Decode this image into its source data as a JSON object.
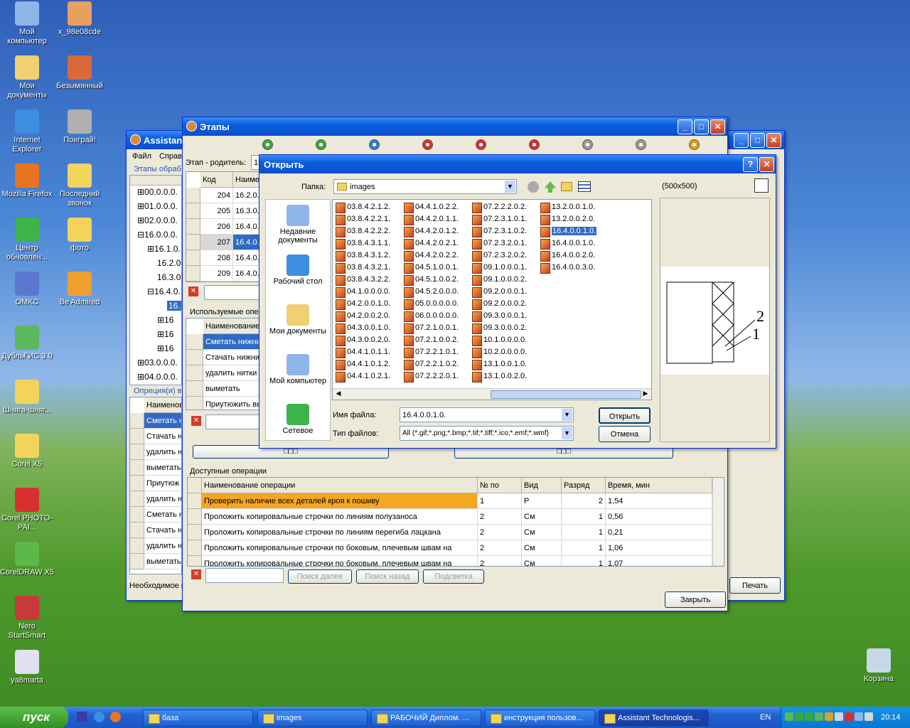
{
  "desktop_icons": [
    {
      "label": "Мой компьютер"
    },
    {
      "label": "x_98e08cde"
    },
    {
      "label": "Мои документы"
    },
    {
      "label": "Безымянный"
    },
    {
      "label": "Internet Explorer"
    },
    {
      "label": "Поиграй!"
    },
    {
      "label": "Mozilla Firefox"
    },
    {
      "label": "Последний звонок"
    },
    {
      "label": "Центр обновлен..."
    },
    {
      "label": "фото"
    },
    {
      "label": "OMKC"
    },
    {
      "label": "Be Admired"
    },
    {
      "label": "ДубльГИС 3.0"
    },
    {
      "label": "Шняга-шняг..."
    },
    {
      "label": "Corel X5"
    },
    {
      "label": "Corel PHOTO-PAI..."
    },
    {
      "label": "CorelDRAW X5"
    },
    {
      "label": "Nero StartSmart"
    },
    {
      "label": "ya8marta"
    },
    {
      "label": "Корзина"
    }
  ],
  "assistant_window": {
    "title": "Assistant",
    "menu": [
      "Файл",
      "Справ"
    ],
    "stages_label": "Этапы обраб",
    "tree": [
      "⊞00.0.0.0.",
      "⊞01.0.0.0.",
      "⊞02.0.0.0.",
      "⊟16.0.0.0.",
      "⊞16.1.0.",
      "16.2.0.",
      "16.3.0.",
      "⊟16.4.0.",
      "16.",
      "⊞16",
      "⊞16",
      "⊞16",
      "⊞03.0.0.0.",
      "⊞04.0.0.0.",
      "⊞05.0.0.0."
    ],
    "ops_label": "Опреция(и) в",
    "ops_header": "Наименов",
    "ops_rows": [
      "Сметать н",
      "Стачать н",
      "удалить н",
      "выметать",
      "Приутюж",
      "удалить н",
      "Сметать н",
      "Стачать н",
      "удалить н",
      "выметать"
    ],
    "status": "Необходимое в",
    "print_button": "Печать"
  },
  "stages_window": {
    "title": "Этапы",
    "parent_label": "Этап - родитель:",
    "parent_value": "16",
    "columns": [
      "Код",
      "Наимен"
    ],
    "rows": [
      {
        "code": "204",
        "name": "16.2.0."
      },
      {
        "code": "205",
        "name": "16.3.0."
      },
      {
        "code": "206",
        "name": "16.4.0."
      },
      {
        "code": "207",
        "name": "16.4.0."
      },
      {
        "code": "208",
        "name": "16.4.0."
      },
      {
        "code": "209",
        "name": "16.4.0."
      }
    ],
    "used_ops_label": "Используемые опер",
    "used_ops_header": "Наименование",
    "used_ops": [
      "Сметать нижни",
      "Стачать нижни",
      "удалить нитки",
      "выметать",
      "Приутюжить вы"
    ],
    "bottom_btn1": "□□□",
    "bottom_btn2": "□□□",
    "avail_label": "Доступные операции",
    "avail_columns": [
      "Наименование операции",
      "№ по",
      "Вид",
      "Разряд",
      "Время, мин"
    ],
    "avail_rows": [
      {
        "name": "Проверить наличие всех деталей кроя к пошиву",
        "num": "1",
        "kind": "Р",
        "grade": "2",
        "time": "1,54"
      },
      {
        "name": "Проложить копировальные строчки по линиям полузаноса",
        "num": "2",
        "kind": "См",
        "grade": "1",
        "time": "0,56"
      },
      {
        "name": "Проложить копировальные строчки по линиям перегиба лацкана",
        "num": "2",
        "kind": "См",
        "grade": "1",
        "time": "0,21"
      },
      {
        "name": "Проложить копировальные строчки по боковым, плечевым швам на",
        "num": "2",
        "kind": "См",
        "grade": "1",
        "time": "1,06"
      },
      {
        "name": "Проложить копировальные строчки по боковым, плечевым швам на",
        "num": "2",
        "kind": "См",
        "grade": "1",
        "time": "1,07"
      }
    ],
    "search_next": "Поиск далее",
    "search_prev": "Поиск назад",
    "highlight": "Подсветка",
    "close_button": "Закрыть"
  },
  "open_dialog": {
    "title": "Открыть",
    "folder_label": "Папка:",
    "folder_value": "images",
    "places": [
      "Недавние документы",
      "Рабочий стол",
      "Мои документы",
      "Мой компьютер",
      "Сетевое"
    ],
    "files": [
      "03.8.4.2.1.2.",
      "03.8.4.2.2.1.",
      "03.8.4.2.2.2.",
      "03.8.4.3.1.1.",
      "03.8.4.3.1.2.",
      "03.8.4.3.2.1.",
      "03.8.4.3.2.2.",
      "04.1.0.0.0.0.",
      "04.2.0.0.1.0.",
      "04.2.0.0.2.0.",
      "04.3.0.0.1.0.",
      "04.3.0.0.2.0.",
      "04.4.1.0.1.1.",
      "04.4.1.0.1.2.",
      "04.4.1.0.2.1.",
      "04.4.1.0.2.2.",
      "04.4.2.0.1.1.",
      "04.4.2.0.1.2.",
      "04.4.2.0.2.1.",
      "04.4.2.0.2.2.",
      "04.5.1.0.0.1.",
      "04.5.1.0.0.2.",
      "04.5.2.0.0.0.",
      "05.0.0.0.0.0.",
      "06.0.0.0.0.0.",
      "07.2.1.0.0.1.",
      "07.2.1.0.0.2.",
      "07.2.2.1.0.1.",
      "07.2.2.1.0.2.",
      "07.2.2.2.0.1.",
      "07.2.2.2.0.2.",
      "07.2.3.1.0.1.",
      "07.2.3.1.0.2.",
      "07.2.3.2.0.1.",
      "07.2.3.2.0.2.",
      "09.1.0.0.0.1.",
      "09.1.0.0.0.2.",
      "09.2.0.0.0.1.",
      "09.2.0.0.0.2.",
      "09.3.0.0.0.1.",
      "09.3.0.0.0.2.",
      "10.1.0.0.0.0.",
      "10.2.0.0.0.0.",
      "13.1.0.0.1.0.",
      "13.1.0.0.2.0.",
      "13.2.0.0.1.0.",
      "13.2.0.0.2.0.",
      "16.4.0.0.1.0.",
      "16.4.0.0.1.0.",
      "16.4.0.0.2.0.",
      "16.4.0.0.3.0."
    ],
    "selected_index": 47,
    "filename_label": "Имя файла:",
    "filename_value": "16.4.0.0.1.0.",
    "filetype_label": "Тип файлов:",
    "filetype_value": "All (*.gif;*.png;*.bmp;*.tif;*.tiff;*.ico;*.emf;*.wmf)",
    "open_button": "Открыть",
    "cancel_button": "Отмена",
    "preview_size": "(500x500)",
    "preview_labels": [
      "2",
      "1"
    ]
  },
  "taskbar": {
    "start": "пуск",
    "items": [
      "база",
      "images",
      "РАБОЧИЙ Диплом. ...",
      "инструкция пользов...",
      "Assistant Technologis..."
    ],
    "lang": "EN",
    "clock": "20:14"
  }
}
